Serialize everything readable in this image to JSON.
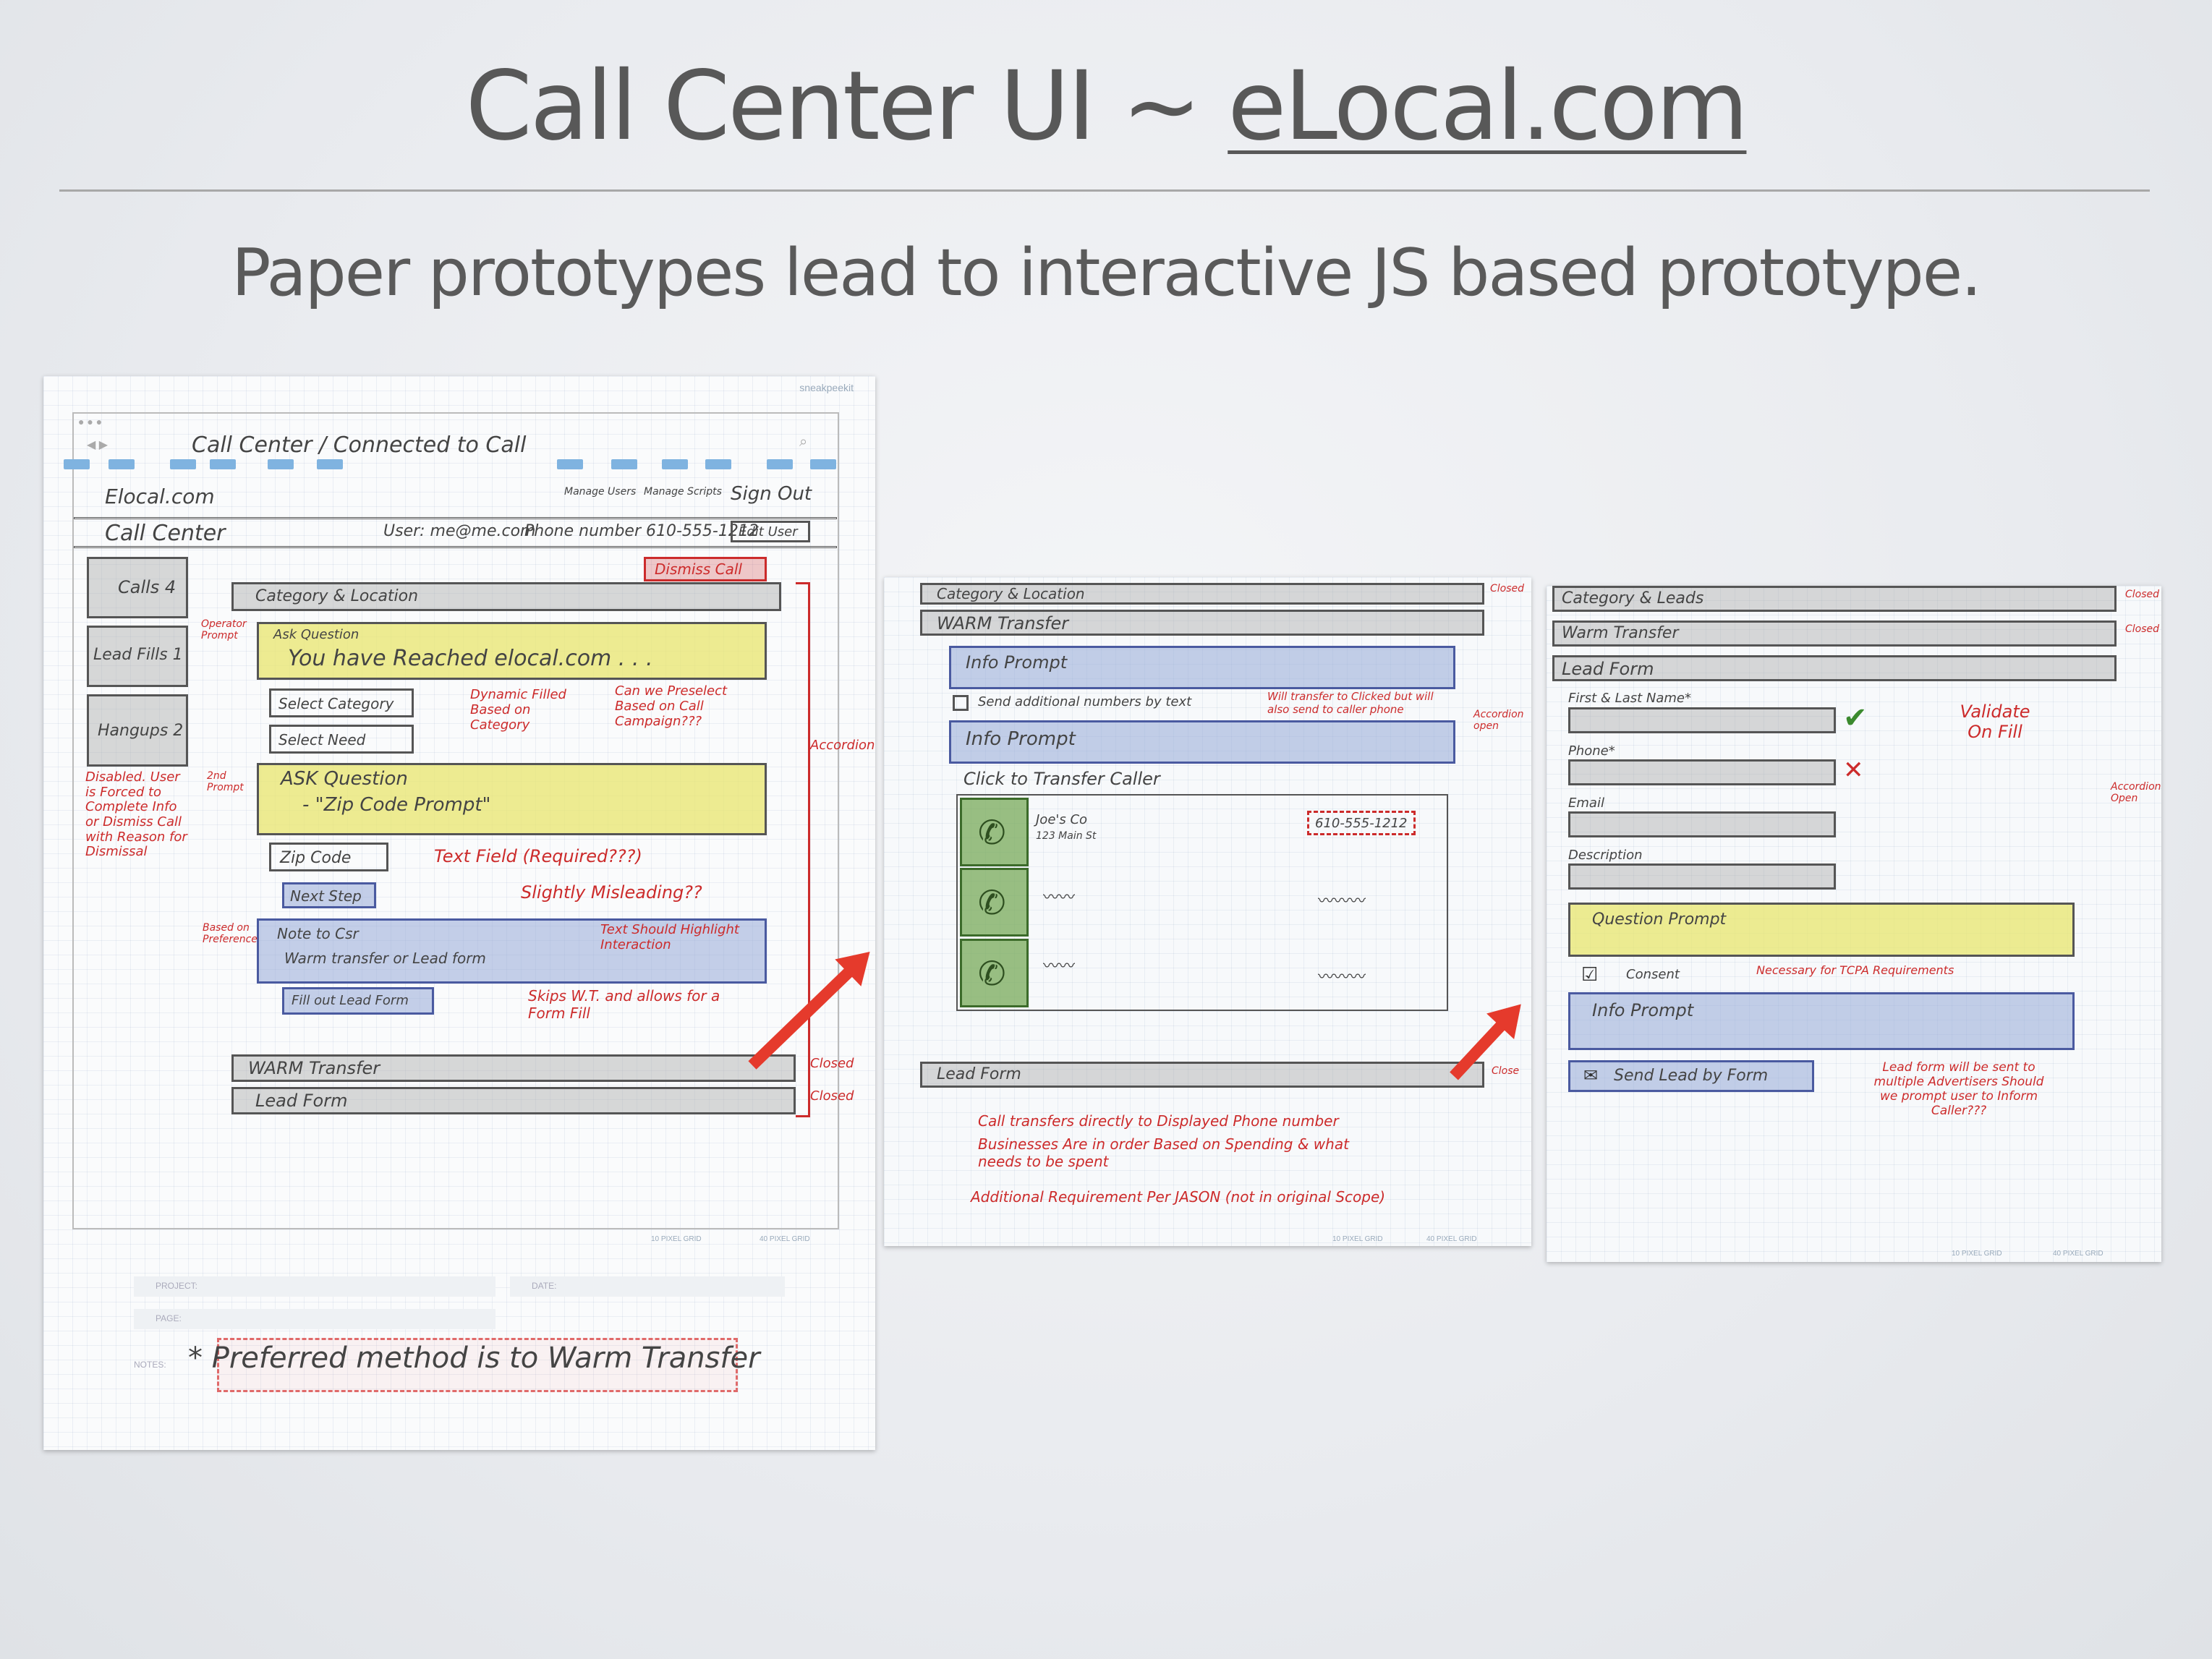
{
  "slide": {
    "title_prefix": "Call Center UI ~ ",
    "title_link": "eLocal.com",
    "subtitle": "Paper prototypes lead to interactive JS based prototype."
  },
  "sketch1": {
    "browser_address": "Call Center / Connected to Call",
    "logo": "Elocal.com",
    "manage_users": "Manage Users",
    "manage_scripts": "Manage Scripts",
    "sign_out": "Sign Out",
    "page_name": "Call Center",
    "user_label": "User: me@me.com",
    "phone_label": "Phone number 610-555-1212",
    "edit_user": "Edit User",
    "dismiss_call": "Dismiss Call",
    "side_calls": "Calls 4",
    "side_lead_fills": "Lead Fills 1",
    "side_hangups": "Hangups 2",
    "category_header": "Category & Location",
    "ask_question_1": "Ask Question",
    "ask_question_1_text": "You have Reached elocal.com . . .",
    "select_category": "Select Category",
    "select_need": "Select Need",
    "ask_question_2": "ASK Question",
    "ask_question_2_text": "- \"Zip Code Prompt\"",
    "zip_code": "Zip Code",
    "next_step": "Next Step",
    "note_to_csr": "Note to Csr",
    "note_text": "Warm transfer or Lead form",
    "fill_lead_form": "Fill out Lead Form",
    "warm_transfer": "WARM Transfer",
    "lead_form": "Lead Form",
    "note_operator_prompt": "Operator Prompt",
    "note_2nd_prompt": "2nd Prompt",
    "note_dynamic": "Dynamic Filled Based on Category",
    "note_preselect": "Can we Preselect Based on Call Campaign???",
    "note_text_field": "Text Field (Required???)",
    "note_misleading": "Slightly Misleading??",
    "note_highlight": "Text Should Highlight Interaction",
    "note_skips": "Skips W.T. and allows for a Form Fill",
    "note_disabled": "Disabled. User is Forced to Complete Info or Dismiss Call with Reason for Dismissal",
    "note_based_pref": "Based on Preference",
    "note_accordion": "Accordion",
    "note_closed_1": "Closed",
    "note_closed_2": "Closed",
    "footer_project": "PROJECT:",
    "footer_date": "DATE:",
    "footer_page": "PAGE:",
    "footer_notes": "NOTES:",
    "footer_note_text": "* Preferred method is to Warm Transfer",
    "grid_label": "10 PIXEL GRID",
    "grid_label_2": "40 PIXEL GRID",
    "brand": "sneakpeekit"
  },
  "sketch2": {
    "category_header": "Category & Location",
    "warm_transfer": "WARM Transfer",
    "info_prompt_1": "Info Prompt",
    "send_numbers": "Send additional numbers by text",
    "note_will_transfer": "Will transfer to Clicked but will also send to caller phone",
    "info_prompt_2": "Info Prompt",
    "click_transfer": "Click to Transfer Caller",
    "biz_name": "Joe's Co",
    "biz_address": "123 Main St",
    "biz_phone": "610-555-1212",
    "lead_form": "Lead Form",
    "note_call_transfers": "Call transfers directly to Displayed Phone number",
    "note_order": "Businesses Are in order Based on Spending & what needs to be spent",
    "note_additional": "Additional Requirement Per JASON (not in original Scope)",
    "note_closed": "Closed",
    "note_closed_2": "Close",
    "note_accordion": "Accordion open",
    "grid_label": "10 PIXEL GRID",
    "grid_label_2": "40 PIXEL GRID"
  },
  "sketch3": {
    "category_header": "Category & Leads",
    "warm_transfer": "Warm Transfer",
    "lead_form": "Lead Form",
    "first_last": "First & Last Name*",
    "phone": "Phone*",
    "email": "Email",
    "description": "Description",
    "question_prompt": "Question Prompt",
    "consent": "Consent",
    "note_tcpa": "Necessary for TCPA Requirements",
    "info_prompt": "Info Prompt",
    "send_lead": "Send Lead by Form",
    "note_validate": "Validate On Fill",
    "note_lead_form": "Lead form will be sent to multiple Advertisers Should we prompt user to Inform Caller???",
    "note_closed_1": "Closed",
    "note_closed_2": "Closed",
    "note_accordion": "Accordion Open",
    "grid_label": "10 PIXEL GRID",
    "grid_label_2": "40 PIXEL GRID"
  },
  "colors": {
    "arrow": "#e53a2c",
    "ink_red": "#cc2b2b",
    "highlight_yellow": "#e8e66e",
    "highlight_blue": "#96aad7",
    "phone_green": "#78aa5a"
  }
}
